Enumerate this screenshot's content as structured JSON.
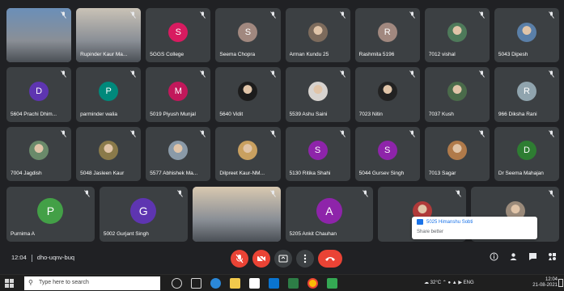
{
  "tiles": [
    {
      "name": "",
      "type": "video",
      "color": "#6b8fb8"
    },
    {
      "name": "Rupinder Kaur Ma...",
      "type": "video",
      "color": "#c9c2b6"
    },
    {
      "name": "5GGS College",
      "type": "letter",
      "letter": "S",
      "color": "#d81b60"
    },
    {
      "name": "Seema Chopra",
      "type": "letter",
      "letter": "S",
      "color": "#a1887f"
    },
    {
      "name": "Arman Kundu 25",
      "type": "photo",
      "color": "#7d6b5c"
    },
    {
      "name": "Rashmita 5196",
      "type": "letter",
      "letter": "R",
      "color": "#a1887f"
    },
    {
      "name": "7012 vishal",
      "type": "photo",
      "color": "#4e7a5a"
    },
    {
      "name": "5043 Dipesh",
      "type": "photo",
      "color": "#5a7fa8"
    },
    {
      "name": "5604 Prachi Dhim...",
      "type": "letter",
      "letter": "D",
      "color": "#5e35b1"
    },
    {
      "name": "parminder walia",
      "type": "letter",
      "letter": "P",
      "color": "#00897b"
    },
    {
      "name": "5019 Piyush Munjal",
      "type": "letter",
      "letter": "M",
      "color": "#c2185b"
    },
    {
      "name": "5640 Vidit",
      "type": "photo",
      "color": "#1c1c1c"
    },
    {
      "name": "5539 Ashu Saini",
      "type": "photo",
      "color": "#d7d3cf"
    },
    {
      "name": "7023 Nitin",
      "type": "photo",
      "color": "#222222"
    },
    {
      "name": "7037 Kush",
      "type": "photo",
      "color": "#4a6b4a"
    },
    {
      "name": "966 Diksha Rani",
      "type": "letter",
      "letter": "R",
      "color": "#90a4ae"
    },
    {
      "name": "7004 Jagdish",
      "type": "photo",
      "color": "#6a8a6a"
    },
    {
      "name": "5048 Jasleen Kaur",
      "type": "photo",
      "color": "#8a7a4a"
    },
    {
      "name": "5577 Abhishek Ma...",
      "type": "photo",
      "color": "#8a9aa8"
    },
    {
      "name": "Dilpreet Kaur-NM...",
      "type": "photo",
      "color": "#c9a060"
    },
    {
      "name": "5130 Ritika Shahi",
      "type": "letter",
      "letter": "S",
      "color": "#8e24aa"
    },
    {
      "name": "5044 Gursev Singh",
      "type": "letter",
      "letter": "S",
      "color": "#8e24aa"
    },
    {
      "name": "7013 Sagar",
      "type": "photo",
      "color": "#b07a4a"
    },
    {
      "name": "Dr Seema Mahajan",
      "type": "letter",
      "letter": "D",
      "color": "#2e7d32"
    }
  ],
  "bottom_tiles": [
    {
      "name": "Purnima A",
      "type": "letter",
      "letter": "P",
      "color": "#43a047"
    },
    {
      "name": "5002 Gurjant Singh",
      "type": "letter",
      "letter": "G",
      "color": "#5e35b1"
    },
    {
      "name": "",
      "type": "video",
      "color": "#d8c8b0"
    },
    {
      "name": "5205 Ankit Chauhan",
      "type": "letter",
      "letter": "A",
      "color": "#8e24aa"
    },
    {
      "name": "",
      "type": "photo",
      "color": "#b03a3a"
    },
    {
      "name": "",
      "type": "photo",
      "color": "#9a8a7a"
    }
  ],
  "toast": {
    "title": "5025 Himanshu Sobti",
    "subtitle": "Share better"
  },
  "meeting": {
    "time": "12:04",
    "code": "dho-uqnv-buq"
  },
  "controls": {
    "mic_icon": "mic-off-icon",
    "cam_icon": "camera-off-icon",
    "present_icon": "present-icon",
    "more_icon": "more-icon",
    "end_icon": "end-call-icon"
  },
  "taskbar": {
    "search_placeholder": "Type here to search",
    "temp": "32°C",
    "lang": "ENG",
    "clock_time": "12:04",
    "clock_date": "21-08-2021"
  },
  "colors": {
    "background": "#202124",
    "tile": "#3c4043",
    "danger": "#ea4335",
    "accent": "#1a73e8"
  }
}
